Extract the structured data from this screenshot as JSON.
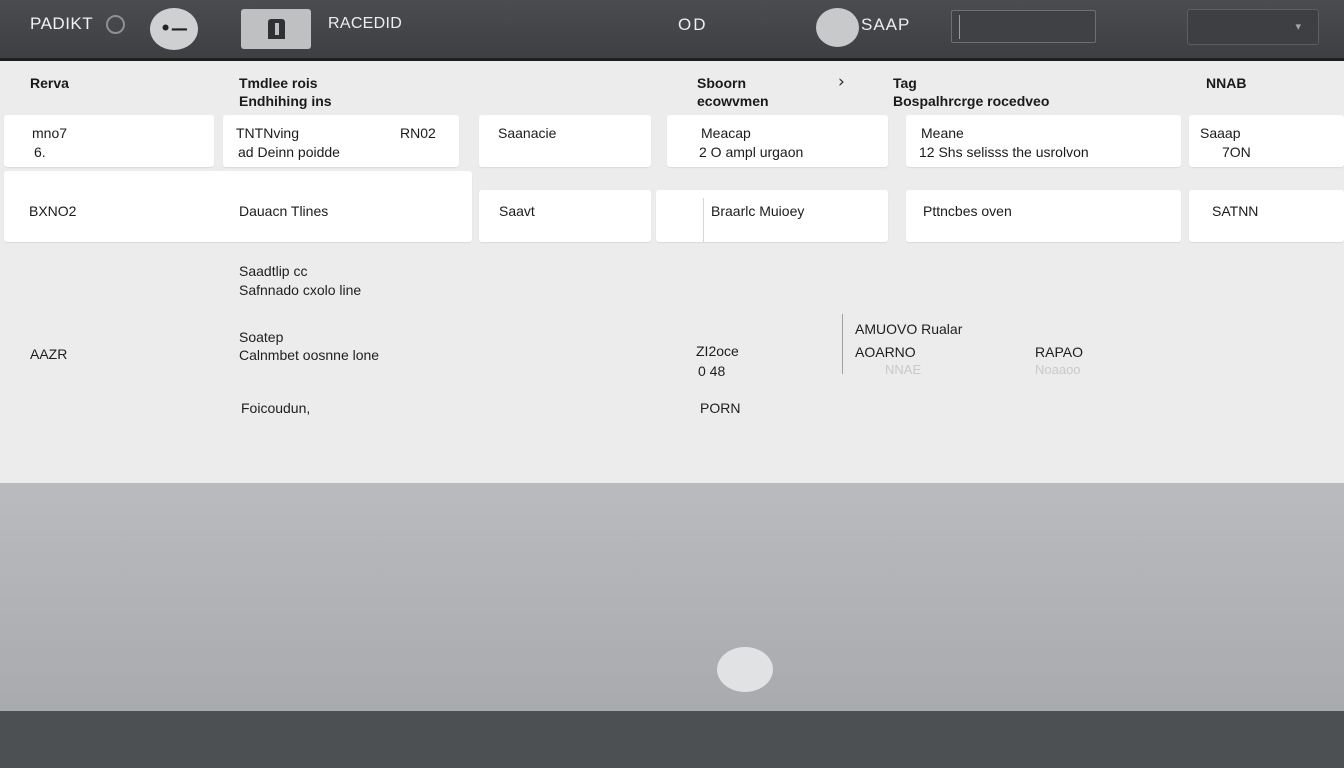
{
  "topbar": {
    "app_title": "PADIKT",
    "menu_glyph": "•—",
    "label_1": "RACEDID",
    "label_2": "OD",
    "label_3": "SAAP",
    "icons": [
      "ring-icon",
      "menu-icon",
      "bookmark-icon",
      "chevron-down-icon"
    ]
  },
  "headers": {
    "c1": "Rerva",
    "c2_line1": "Tmdlee rois",
    "c2_line2": "Endhihing ins",
    "c3_line1": "Sboorn",
    "c3_line2": "ecowvmen",
    "c4_line1": "Tag",
    "c4_line2": "Bospalhrcrge rocedveo",
    "c5": "NNAB"
  },
  "row1": {
    "c1": {
      "l1": "mno7",
      "l2": "6."
    },
    "c2": {
      "l1": "TNTNving",
      "l1b": "RN02",
      "l2": "ad Deinn poidde"
    },
    "c3": {
      "l1": "Saanacie"
    },
    "c4": {
      "l1": "Meacap",
      "l2": "2 O ampl urgaon"
    },
    "c5": {
      "l1": "Meane",
      "l2": "12 Shs selisss the usrolvon"
    },
    "c6": {
      "l1": "Saaap",
      "l2": "7ON"
    }
  },
  "row2": {
    "c1": "BXNO2",
    "c2": "Dauacn Tlines",
    "c3": "Saavt",
    "c4": "Braarlc Muioey",
    "c5": "Pttncbes oven",
    "c6": "SATNN"
  },
  "details": {
    "a_l1": "Saadtlip cc",
    "a_l2": "Safnnado cxolo line",
    "b_left": "AAZR",
    "b_l1": "Soatep",
    "b_l2": "Calnmbet oosnne lone",
    "c_l1": "Foicoudun,",
    "mid_1": "ZI2oce",
    "mid_2": "0    48",
    "mid_3": "PORN",
    "right_title": "AMUOVO Rualar",
    "right_l1": "AOARNO",
    "right_l1_faint": "NNAE",
    "right_l2": "RAPAO",
    "right_l2_faint": "Noaaoo"
  }
}
